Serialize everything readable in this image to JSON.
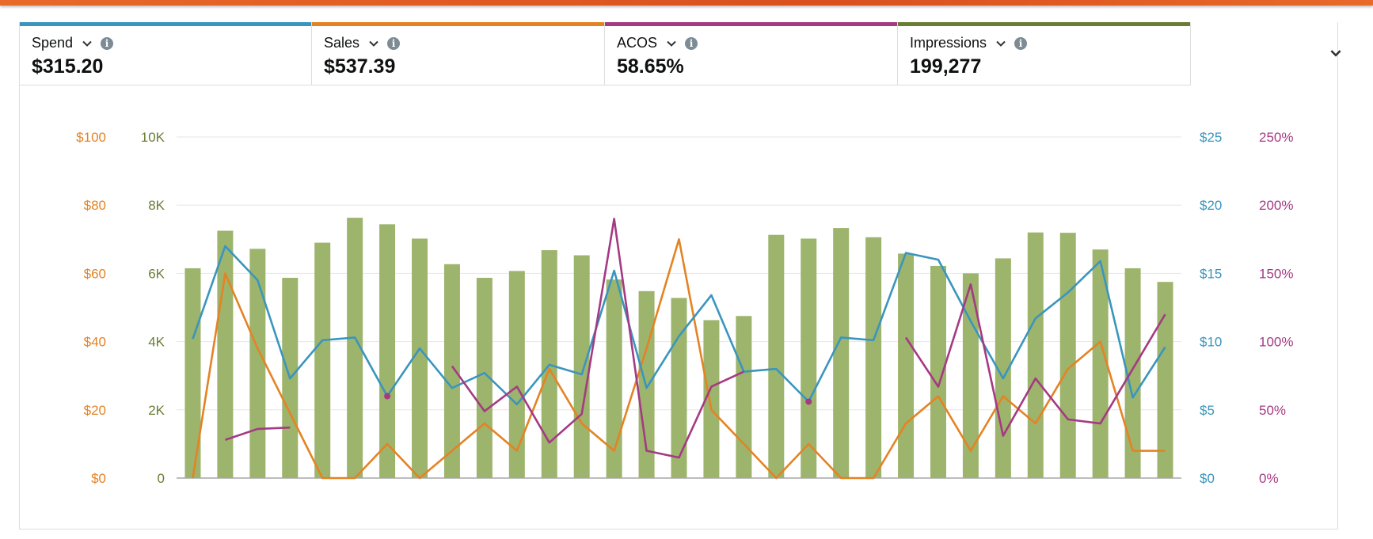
{
  "colors": {
    "spend": "#3a95bd",
    "sales": "#e48324",
    "acos": "#a43a83",
    "impressions": "#6a7d35",
    "impressions_bar": "#9db46d"
  },
  "metrics": [
    {
      "key": "spend",
      "label": "Spend",
      "value": "$315.20",
      "color": "#3a95bd"
    },
    {
      "key": "sales",
      "label": "Sales",
      "value": "$537.39",
      "color": "#e48324"
    },
    {
      "key": "acos",
      "label": "ACOS",
      "value": "58.65%",
      "color": "#a43a83"
    },
    {
      "key": "impressions",
      "label": "Impressions",
      "value": "199,277",
      "color": "#6a7d35"
    }
  ],
  "icons": {
    "dropdown": "chevron-down-icon",
    "info": "info-icon",
    "expand": "chevron-down-icon"
  },
  "chart_data": {
    "type": "bar",
    "combo": "bar+line",
    "grid": true,
    "points": 31,
    "axes": {
      "sales": {
        "side": "left-outer",
        "ticks": [
          "$0",
          "$20",
          "$40",
          "$60",
          "$80",
          "$100"
        ],
        "range": [
          0,
          100
        ]
      },
      "impressions": {
        "side": "left-inner",
        "ticks": [
          "0",
          "2K",
          "4K",
          "6K",
          "8K",
          "10K"
        ],
        "range": [
          0,
          10000
        ]
      },
      "spend": {
        "side": "right-inner",
        "ticks": [
          "$0",
          "$5",
          "$10",
          "$15",
          "$20",
          "$25"
        ],
        "range": [
          0,
          25
        ]
      },
      "acos": {
        "side": "right-outer",
        "ticks": [
          "0%",
          "50%",
          "100%",
          "150%",
          "200%",
          "250%"
        ],
        "range": [
          0,
          250
        ]
      }
    },
    "series": [
      {
        "name": "Impressions",
        "type": "bar",
        "axis": "impressions",
        "values": [
          6150,
          7250,
          6720,
          5870,
          6900,
          7630,
          7440,
          7020,
          6270,
          5870,
          6070,
          6680,
          6530,
          5820,
          5480,
          5280,
          4630,
          4750,
          7130,
          7020,
          7330,
          7060,
          6580,
          6220,
          6000,
          6440,
          7200,
          7190,
          6700,
          6150,
          5750
        ]
      },
      {
        "name": "Spend",
        "type": "line",
        "axis": "spend",
        "values": [
          10.2,
          17.0,
          14.5,
          7.3,
          10.1,
          10.3,
          6.0,
          9.5,
          6.6,
          7.7,
          5.4,
          8.3,
          7.6,
          15.2,
          6.6,
          10.4,
          13.4,
          7.8,
          8.0,
          5.6,
          10.3,
          10.1,
          16.5,
          16.0,
          11.5,
          7.3,
          11.7,
          13.6,
          15.9,
          5.9,
          9.6
        ]
      },
      {
        "name": "Sales",
        "type": "line",
        "axis": "sales",
        "values": [
          0,
          60,
          38,
          19,
          0,
          0,
          10,
          0,
          8,
          16,
          8,
          32,
          16,
          8,
          38,
          70,
          20,
          10,
          0,
          10,
          0,
          0,
          16,
          24,
          8,
          24,
          16,
          32,
          40,
          8,
          8
        ]
      },
      {
        "name": "ACOS",
        "type": "line",
        "axis": "acos",
        "values": [
          null,
          28,
          36,
          37,
          null,
          null,
          60,
          null,
          82,
          49,
          67,
          26,
          47,
          190,
          20,
          15,
          67,
          78,
          null,
          56,
          null,
          null,
          103,
          67,
          142,
          31,
          73,
          43,
          40,
          80,
          120
        ]
      }
    ]
  }
}
